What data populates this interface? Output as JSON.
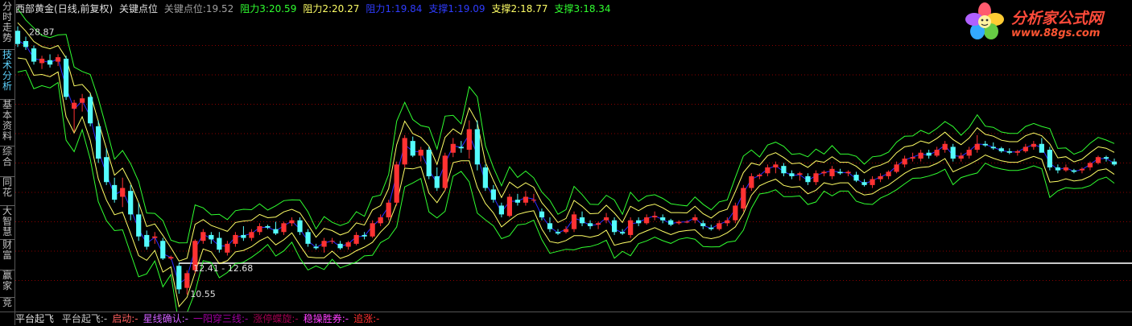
{
  "sidebar": {
    "tabs": [
      {
        "label": "分时走势",
        "active": false
      },
      {
        "label": "技术分析",
        "active": true
      },
      {
        "label": "基本资料",
        "active": false
      },
      {
        "label": "综合",
        "active": false
      },
      {
        "label": "同花",
        "active": false
      },
      {
        "label": "大智慧",
        "active": false
      },
      {
        "label": "财富",
        "active": false
      },
      {
        "label": "赢家",
        "active": false
      },
      {
        "label": "竞",
        "active": false
      }
    ]
  },
  "header": {
    "name": "西部黄金",
    "period": "(日线,前复权)",
    "indicator": "关键点位",
    "items": [
      {
        "label": "关键点位:",
        "value": "19.52",
        "color": "#a0a0a0"
      },
      {
        "label": "阻力3:",
        "value": "20.59",
        "color": "#30ff30"
      },
      {
        "label": "阻力2:",
        "value": "20.27",
        "color": "#ffff66"
      },
      {
        "label": "阻力1:",
        "value": "19.84",
        "color": "#2f3cff"
      },
      {
        "label": "支撑1:",
        "value": "19.09",
        "color": "#2f3cff"
      },
      {
        "label": "支撑2:",
        "value": "18.77",
        "color": "#ffff66"
      },
      {
        "label": "支撑3:",
        "value": "18.34",
        "color": "#30ff30"
      }
    ]
  },
  "annotations": {
    "high": "28.87",
    "range": "12.41 - 12.68",
    "low": "10.55"
  },
  "footer": {
    "title": "平台起飞",
    "items": [
      {
        "text": "平台起飞:-",
        "color": "#c8c8c8"
      },
      {
        "text": "启动:-",
        "color": "#ff6060"
      },
      {
        "text": "星线确认:-",
        "color": "#d060ff"
      },
      {
        "text": "一阳穿三线:-",
        "color": "#a000a0"
      },
      {
        "text": "涨停蝶旋:-",
        "color": "#a00050"
      },
      {
        "text": "稳操胜券:-",
        "color": "#ff40ff"
      },
      {
        "text": "追涨:-",
        "color": "#ff3030"
      }
    ]
  },
  "logo": {
    "brand": "分析家公式网",
    "url": "www.88gs.com"
  },
  "colors": {
    "up": "#ff3232",
    "down": "#54fcfc",
    "key": "#2a2aff",
    "band2": "#ffff66",
    "band3": "#30ff30",
    "grid": "#8c0000",
    "baseline": "#c8c8c8"
  },
  "chart_data": {
    "type": "candlestick",
    "ylim": [
      9.5,
      29.5
    ],
    "reference_line": 12.68,
    "candles": [
      [
        28.5,
        28.8,
        27.4,
        27.6
      ],
      [
        27.8,
        28.1,
        27.2,
        27.4
      ],
      [
        27.3,
        27.5,
        26.2,
        26.4
      ],
      [
        26.3,
        26.8,
        25.9,
        26.6
      ],
      [
        26.5,
        26.9,
        26.0,
        26.2
      ],
      [
        26.4,
        26.9,
        26.1,
        26.7
      ],
      [
        26.6,
        26.8,
        23.8,
        24.0
      ],
      [
        23.2,
        23.8,
        21.6,
        23.6
      ],
      [
        23.6,
        24.2,
        23.0,
        23.9
      ],
      [
        24.0,
        24.2,
        22.0,
        22.2
      ],
      [
        22.0,
        22.4,
        19.5,
        19.8
      ],
      [
        19.9,
        20.5,
        18.0,
        18.2
      ],
      [
        18.0,
        18.5,
        16.8,
        17.0
      ],
      [
        17.2,
        18.5,
        16.5,
        17.8
      ],
      [
        17.6,
        18.0,
        15.6,
        16.0
      ],
      [
        16.0,
        16.8,
        14.2,
        14.5
      ],
      [
        14.6,
        14.9,
        13.6,
        13.8
      ],
      [
        14.4,
        14.8,
        14.0,
        14.5
      ],
      [
        14.2,
        14.4,
        12.9,
        13.0
      ],
      [
        13.0,
        13.2,
        12.9,
        13.1
      ],
      [
        12.5,
        12.7,
        10.6,
        10.9
      ],
      [
        11.0,
        12.2,
        10.55,
        12.0
      ],
      [
        12.2,
        14.3,
        12.0,
        14.2
      ],
      [
        14.2,
        15.0,
        14.0,
        14.8
      ],
      [
        14.6,
        14.8,
        14.0,
        14.3
      ],
      [
        14.4,
        14.8,
        13.4,
        13.6
      ],
      [
        13.4,
        14.2,
        13.2,
        14.0
      ],
      [
        14.0,
        14.8,
        13.8,
        14.6
      ],
      [
        14.6,
        15.2,
        14.2,
        14.4
      ],
      [
        14.4,
        15.0,
        14.2,
        14.8
      ],
      [
        14.8,
        15.4,
        14.6,
        15.2
      ],
      [
        15.2,
        15.3,
        15.0,
        15.1
      ],
      [
        15.0,
        15.5,
        14.6,
        14.7
      ],
      [
        14.8,
        15.5,
        14.6,
        15.4
      ],
      [
        15.4,
        15.8,
        15.2,
        15.6
      ],
      [
        15.6,
        15.8,
        14.6,
        14.8
      ],
      [
        14.8,
        15.0,
        13.8,
        14.0
      ],
      [
        13.8,
        14.0,
        13.6,
        13.7
      ],
      [
        13.8,
        14.4,
        13.4,
        14.2
      ],
      [
        14.2,
        14.4,
        14.0,
        14.2
      ],
      [
        14.0,
        14.2,
        13.6,
        13.7
      ],
      [
        13.8,
        14.2,
        13.6,
        14.1
      ],
      [
        14.0,
        14.8,
        13.9,
        14.6
      ],
      [
        14.6,
        14.8,
        14.3,
        14.5
      ],
      [
        14.5,
        15.6,
        14.4,
        15.4
      ],
      [
        15.4,
        16.0,
        15.2,
        15.8
      ],
      [
        15.8,
        17.0,
        15.6,
        16.8
      ],
      [
        16.8,
        19.6,
        16.6,
        19.4
      ],
      [
        19.4,
        21.4,
        19.2,
        21.2
      ],
      [
        21.0,
        21.3,
        19.9,
        20.0
      ],
      [
        20.0,
        20.6,
        19.6,
        20.4
      ],
      [
        20.4,
        20.6,
        18.4,
        18.6
      ],
      [
        18.6,
        19.2,
        17.6,
        17.8
      ],
      [
        17.8,
        20.2,
        17.6,
        20.0
      ],
      [
        20.2,
        21.2,
        19.9,
        20.8
      ],
      [
        20.6,
        21.0,
        20.2,
        20.5
      ],
      [
        20.4,
        22.4,
        19.8,
        21.8
      ],
      [
        21.8,
        22.4,
        19.0,
        19.4
      ],
      [
        19.2,
        19.4,
        17.6,
        17.8
      ],
      [
        17.7,
        18.0,
        16.8,
        17.0
      ],
      [
        16.6,
        16.8,
        15.8,
        16.0
      ],
      [
        15.9,
        17.4,
        15.8,
        17.2
      ],
      [
        17.0,
        17.4,
        16.6,
        16.8
      ],
      [
        16.8,
        17.6,
        16.6,
        17.2
      ],
      [
        17.0,
        17.4,
        16.8,
        17.0
      ],
      [
        16.2,
        16.4,
        15.6,
        15.8
      ],
      [
        15.4,
        15.8,
        14.8,
        15.0
      ],
      [
        14.8,
        15.0,
        14.6,
        14.7
      ],
      [
        14.8,
        15.2,
        14.7,
        15.0
      ],
      [
        15.0,
        16.2,
        14.8,
        16.0
      ],
      [
        15.8,
        16.2,
        15.2,
        15.4
      ],
      [
        15.4,
        15.6,
        15.0,
        15.2
      ],
      [
        15.3,
        15.5,
        15.0,
        15.4
      ],
      [
        15.6,
        16.1,
        15.4,
        15.8
      ],
      [
        15.6,
        15.8,
        14.6,
        14.8
      ],
      [
        14.8,
        15.0,
        14.6,
        14.7
      ],
      [
        14.6,
        15.8,
        14.4,
        15.6
      ],
      [
        15.6,
        15.8,
        15.2,
        15.4
      ],
      [
        15.4,
        16.0,
        15.3,
        15.8
      ],
      [
        15.8,
        16.2,
        15.6,
        15.9
      ],
      [
        15.8,
        16.0,
        15.4,
        15.6
      ],
      [
        15.6,
        15.7,
        15.2,
        15.3
      ],
      [
        15.4,
        15.6,
        15.3,
        15.5
      ],
      [
        15.5,
        15.6,
        15.4,
        15.5
      ],
      [
        15.6,
        16.0,
        15.4,
        15.8
      ],
      [
        15.4,
        15.6,
        15.0,
        15.2
      ],
      [
        15.1,
        15.3,
        14.9,
        15.0
      ],
      [
        15.0,
        15.6,
        14.9,
        15.4
      ],
      [
        15.4,
        15.8,
        15.2,
        15.6
      ],
      [
        15.6,
        16.8,
        15.4,
        16.6
      ],
      [
        16.4,
        18.0,
        16.2,
        17.8
      ],
      [
        17.8,
        18.8,
        17.6,
        18.6
      ],
      [
        18.6,
        18.8,
        18.4,
        18.7
      ],
      [
        18.8,
        19.4,
        18.6,
        19.2
      ],
      [
        19.2,
        19.6,
        18.8,
        19.4
      ],
      [
        19.3,
        19.5,
        18.6,
        18.8
      ],
      [
        18.8,
        19.0,
        18.4,
        18.6
      ],
      [
        18.7,
        18.9,
        18.3,
        18.8
      ],
      [
        18.6,
        18.8,
        18.0,
        18.2
      ],
      [
        18.2,
        19.0,
        18.0,
        18.8
      ],
      [
        18.8,
        19.0,
        18.6,
        18.9
      ],
      [
        18.6,
        19.3,
        18.4,
        19.1
      ],
      [
        18.9,
        19.1,
        18.7,
        18.8
      ],
      [
        18.8,
        19.0,
        18.6,
        18.9
      ],
      [
        18.7,
        18.9,
        18.2,
        18.3
      ],
      [
        18.2,
        18.4,
        17.9,
        18.0
      ],
      [
        18.0,
        18.6,
        17.8,
        18.4
      ],
      [
        18.4,
        18.8,
        18.2,
        18.6
      ],
      [
        18.6,
        19.0,
        18.4,
        18.9
      ],
      [
        18.9,
        19.6,
        18.8,
        19.4
      ],
      [
        19.4,
        20.0,
        19.2,
        19.8
      ],
      [
        19.8,
        20.2,
        19.6,
        19.9
      ],
      [
        19.8,
        20.4,
        19.6,
        20.2
      ],
      [
        20.2,
        20.4,
        19.8,
        20.0
      ],
      [
        20.0,
        20.6,
        19.9,
        20.4
      ],
      [
        20.4,
        21.0,
        20.2,
        20.8
      ],
      [
        20.6,
        20.8,
        19.6,
        19.8
      ],
      [
        19.8,
        20.2,
        19.6,
        20.0
      ],
      [
        20.0,
        20.6,
        19.8,
        20.4
      ],
      [
        20.4,
        21.4,
        20.2,
        20.8
      ],
      [
        20.8,
        21.0,
        20.6,
        20.7
      ],
      [
        20.6,
        20.9,
        20.4,
        20.5
      ],
      [
        20.5,
        20.6,
        20.2,
        20.3
      ],
      [
        20.3,
        20.5,
        20.1,
        20.2
      ],
      [
        20.2,
        20.4,
        20.0,
        20.3
      ],
      [
        20.3,
        20.8,
        20.2,
        20.6
      ],
      [
        20.6,
        21.0,
        20.4,
        20.8
      ],
      [
        20.8,
        21.2,
        20.6,
        20.2
      ],
      [
        20.4,
        20.6,
        19.0,
        19.2
      ],
      [
        19.2,
        19.4,
        18.8,
        19.0
      ],
      [
        19.0,
        19.4,
        18.9,
        19.2
      ],
      [
        19.0,
        19.1,
        18.8,
        18.9
      ],
      [
        19.0,
        19.2,
        18.8,
        19.1
      ],
      [
        19.2,
        19.6,
        19.0,
        19.5
      ],
      [
        19.5,
        20.0,
        19.4,
        19.9
      ],
      [
        19.9,
        20.0,
        19.6,
        19.8
      ],
      [
        19.6,
        19.8,
        19.3,
        19.4
      ]
    ]
  }
}
